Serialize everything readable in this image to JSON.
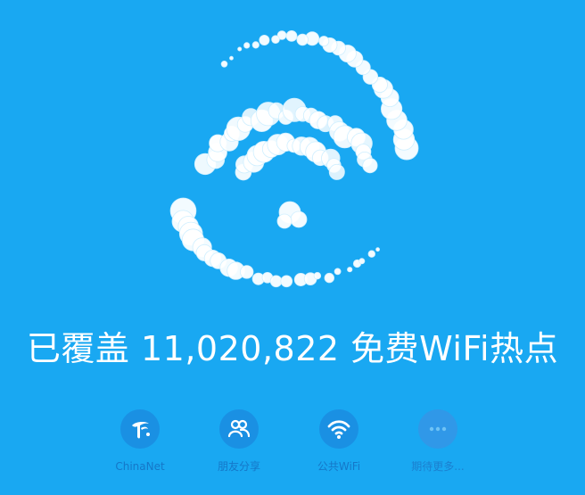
{
  "headline": {
    "prefix": "已覆盖",
    "count": "11,020,822",
    "suffix": "免费WiFi热点"
  },
  "shortcuts": [
    {
      "label": "ChinaNet",
      "icon": "china-telecom-logo-icon"
    },
    {
      "label": "朋友分享",
      "icon": "friends-icon"
    },
    {
      "label": "公共WiFi",
      "icon": "wifi-icon"
    },
    {
      "label": "期待更多...",
      "icon": "more-dots-icon"
    }
  ],
  "colors": {
    "background": "#19A8F2",
    "icon_circle": "#1A90E3",
    "label": "#1577C8",
    "bubble": "#FFFFFF"
  }
}
